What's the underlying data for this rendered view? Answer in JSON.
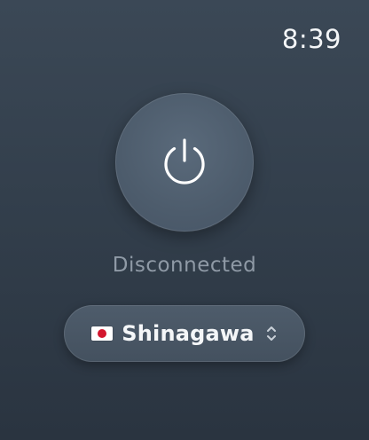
{
  "status_bar": {
    "time": "8:39"
  },
  "power": {
    "icon": "power-icon"
  },
  "connection": {
    "status": "Disconnected"
  },
  "location": {
    "flag_icon": "japan-flag-icon",
    "name": "Shinagawa",
    "picker_icon": "chevron-up-down-icon"
  },
  "colors": {
    "background_top": "#3b4856",
    "background_bottom": "#2a3440",
    "button": "#4d5c6c",
    "status_text": "#8f9aa6",
    "flag_red": "#d3162e"
  }
}
